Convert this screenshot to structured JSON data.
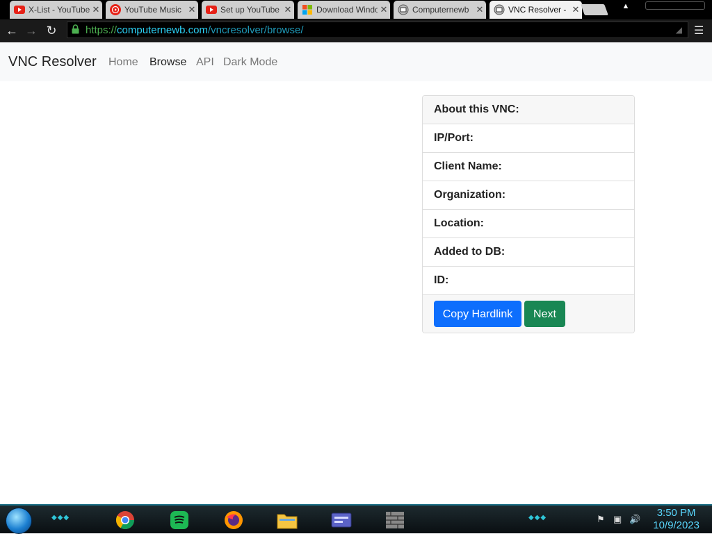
{
  "tabs": [
    {
      "title": "X-List - YouTube",
      "icon": "youtube-icon",
      "active": false
    },
    {
      "title": "YouTube Music",
      "icon": "youtube-music-icon",
      "active": false
    },
    {
      "title": "Set up YouTube",
      "icon": "youtube-icon",
      "active": false
    },
    {
      "title": "Download Windows",
      "icon": "microsoft-icon",
      "active": false
    },
    {
      "title": "Computernewb",
      "icon": "computernewb-icon",
      "active": false
    },
    {
      "title": "VNC Resolver - ",
      "icon": "computernewb-icon",
      "active": true
    }
  ],
  "toolbar": {
    "url_scheme": "https://",
    "url_host": "computernewb.com",
    "url_path": "/vncresolver/browse/"
  },
  "navbar": {
    "brand": "VNC Resolver",
    "links": [
      "Home",
      "Browse",
      "API",
      "Dark Mode"
    ],
    "active": "Browse"
  },
  "card": {
    "header": "About this VNC:",
    "fields": [
      "IP/Port:",
      "Client Name:",
      "Organization:",
      "Location:",
      "Added to DB:",
      "ID:"
    ],
    "buttons": {
      "copy": "Copy Hardlink",
      "next": "Next"
    }
  },
  "taskbar": {
    "time": "3:50 PM",
    "date": "10/9/2023",
    "pinned": [
      "chrome-icon",
      "spotify-icon",
      "firefox-icon",
      "file-explorer-icon",
      "app-window-icon",
      "app-grid-icon"
    ]
  },
  "colors": {
    "primary": "#0d6efd",
    "success": "#198754",
    "url_host": "#2bd1f5",
    "url_scheme": "#4caf50"
  }
}
